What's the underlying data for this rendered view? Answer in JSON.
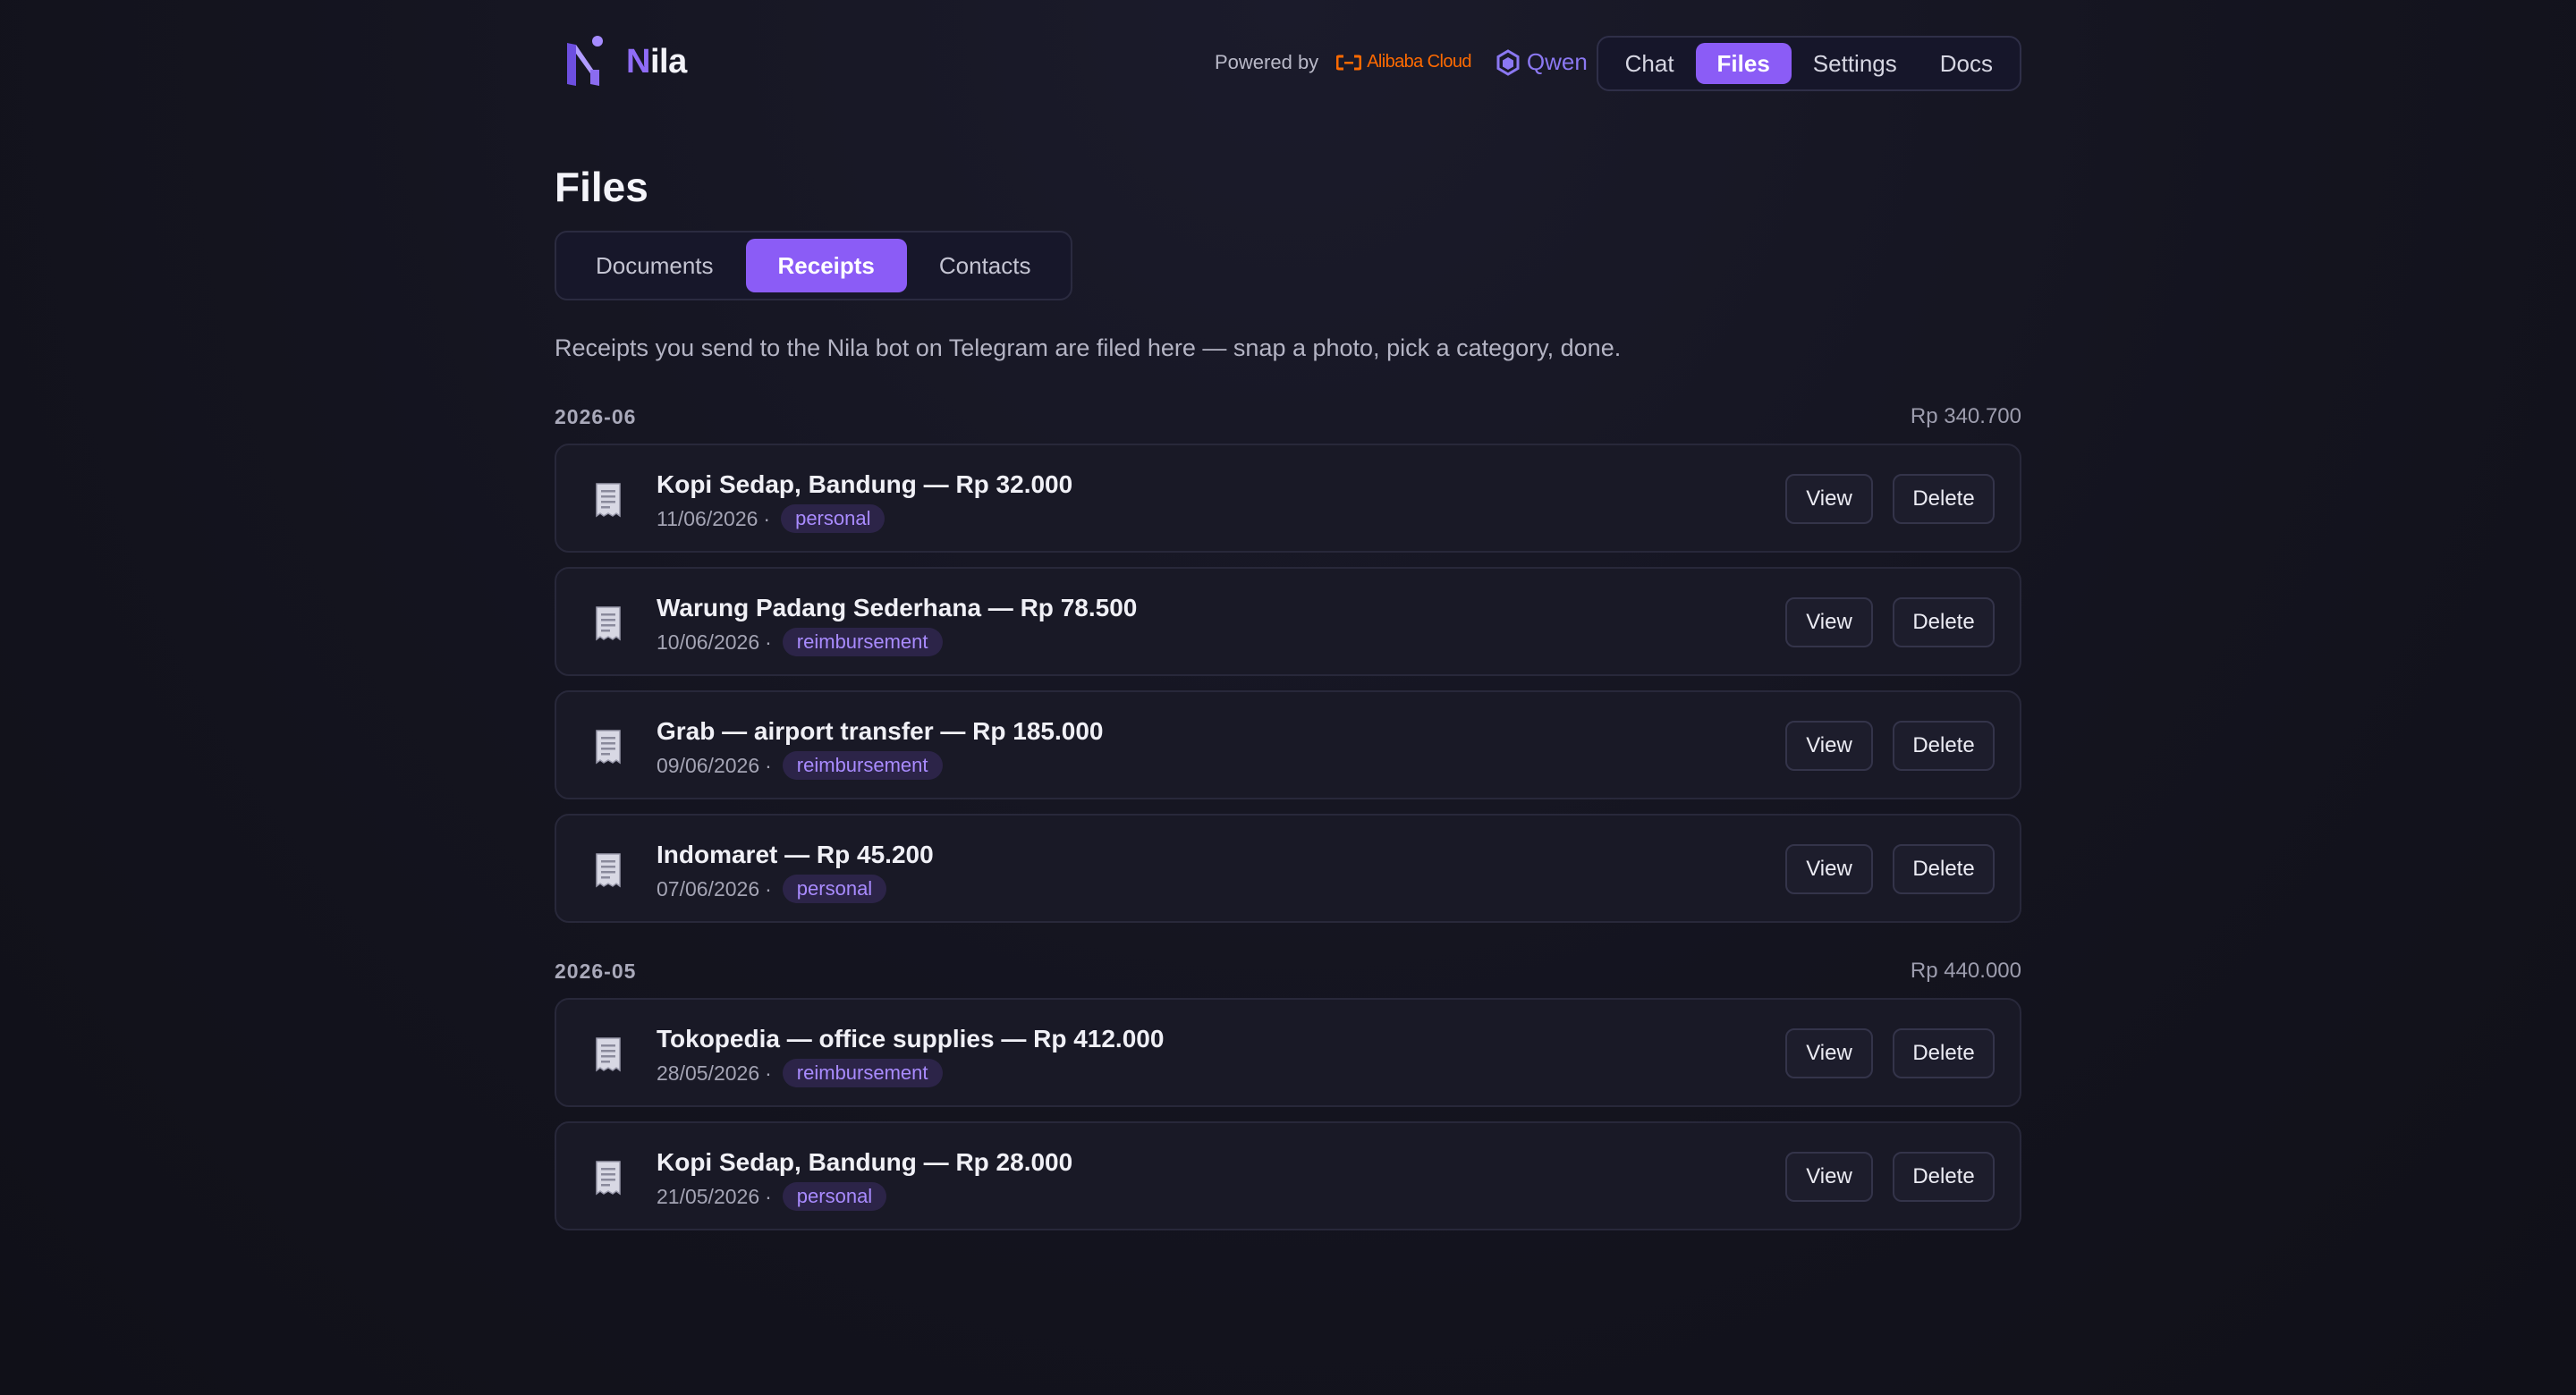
{
  "brand": {
    "name_initial": "N",
    "name_rest": "ila"
  },
  "powered_by": {
    "label": "Powered by",
    "alibaba": "Alibaba Cloud",
    "qwen": "Qwen"
  },
  "nav": [
    {
      "label": "Chat",
      "active": false
    },
    {
      "label": "Files",
      "active": true
    },
    {
      "label": "Settings",
      "active": false
    },
    {
      "label": "Docs",
      "active": false
    }
  ],
  "page_title": "Files",
  "tabs": [
    {
      "label": "Documents",
      "active": false
    },
    {
      "label": "Receipts",
      "active": true
    },
    {
      "label": "Contacts",
      "active": false
    }
  ],
  "description": "Receipts you send to the Nila bot on Telegram are filed here — snap a photo, pick a category, done.",
  "groups": [
    {
      "label": "2026-06",
      "total": "Rp 340.700",
      "items": [
        {
          "title": "Kopi Sedap, Bandung — Rp 32.000",
          "date": "11/06/2026",
          "category": "personal"
        },
        {
          "title": "Warung Padang Sederhana — Rp 78.500",
          "date": "10/06/2026",
          "category": "reimbursement"
        },
        {
          "title": "Grab — airport transfer — Rp 185.000",
          "date": "09/06/2026",
          "category": "reimbursement"
        },
        {
          "title": "Indomaret — Rp 45.200",
          "date": "07/06/2026",
          "category": "personal"
        }
      ]
    },
    {
      "label": "2026-05",
      "total": "Rp 440.000",
      "items": [
        {
          "title": "Tokopedia — office supplies — Rp 412.000",
          "date": "28/05/2026",
          "category": "reimbursement"
        },
        {
          "title": "Kopi Sedap, Bandung — Rp 28.000",
          "date": "21/05/2026",
          "category": "personal"
        }
      ]
    }
  ],
  "actions": {
    "view": "View",
    "delete": "Delete",
    "separator": "·"
  },
  "colors": {
    "accent": "#8b5cf6",
    "background": "#14141f",
    "card": "#191926",
    "pill_bg": "#2c2448",
    "pill_text": "#a98bff",
    "alibaba": "#ff6a00",
    "qwen": "#8b78f2"
  },
  "icons": {
    "logo": "nila-logo",
    "row": "receipt-icon",
    "alibaba": "alibaba-cloud-icon",
    "qwen": "qwen-icon"
  }
}
